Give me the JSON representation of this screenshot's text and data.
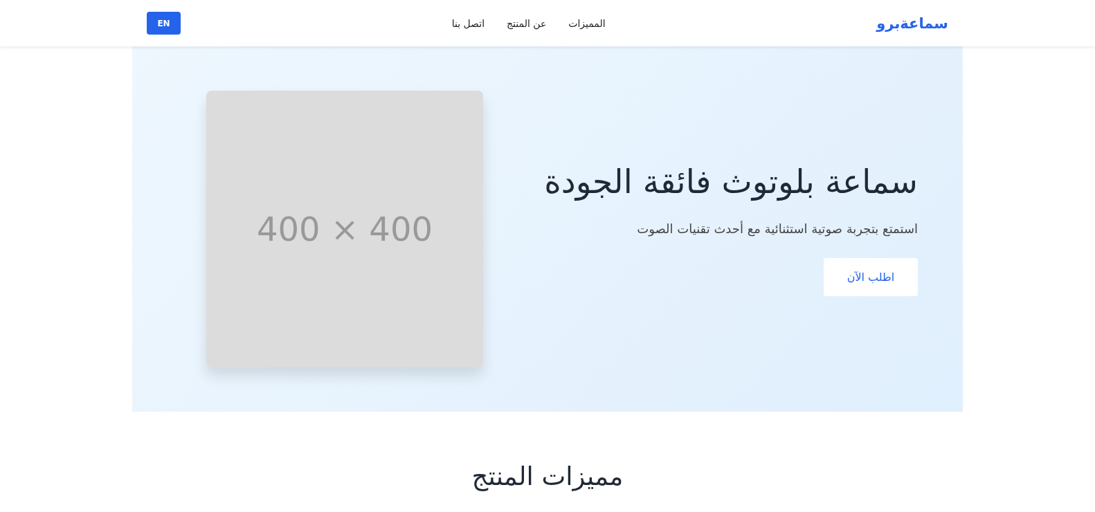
{
  "header": {
    "logo": "سماعةبرو",
    "nav": [
      {
        "label": "المميزات"
      },
      {
        "label": "عن المنتج"
      },
      {
        "label": "اتصل بنا"
      }
    ],
    "language_button": "EN"
  },
  "hero": {
    "title": "سماعة بلوتوث فائقة الجودة",
    "subtitle": "استمتع بتجربة صوتية استثنائية مع أحدث تقنيات الصوت",
    "button": "اطلب الآن",
    "image_placeholder": "400 × 400"
  },
  "features": {
    "title": "مميزات المنتج"
  }
}
